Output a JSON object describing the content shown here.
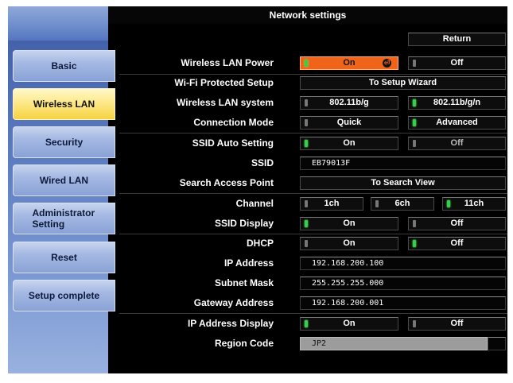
{
  "window": {
    "title": "Network settings"
  },
  "sidebar": {
    "items": [
      {
        "label": "Basic",
        "active": false
      },
      {
        "label": "Wireless LAN",
        "active": true
      },
      {
        "label": "Security",
        "active": false
      },
      {
        "label": "Wired LAN",
        "active": false
      },
      {
        "label": "Administrator Setting",
        "active": false
      },
      {
        "label": "Reset",
        "active": false
      },
      {
        "label": "Setup complete",
        "active": false
      }
    ]
  },
  "header": {
    "return_label": "Return"
  },
  "settings": {
    "wireless_lan_power": {
      "label": "Wireless LAN Power",
      "on": "On",
      "off": "Off",
      "selected": "On"
    },
    "wps": {
      "label": "Wi-Fi Protected Setup",
      "button": "To Setup Wizard"
    },
    "wireless_lan_system": {
      "label": "Wireless LAN system",
      "opt1": "802.11b/g",
      "opt2": "802.11b/g/n",
      "selected": "802.11b/g/n"
    },
    "connection_mode": {
      "label": "Connection Mode",
      "opt1": "Quick",
      "opt2": "Advanced",
      "selected": "Advanced"
    },
    "ssid_auto": {
      "label": "SSID Auto Setting",
      "on": "On",
      "off": "Off",
      "selected": "On"
    },
    "ssid": {
      "label": "SSID",
      "value": "EB79013F"
    },
    "search_ap": {
      "label": "Search Access Point",
      "button": "To Search View"
    },
    "channel": {
      "label": "Channel",
      "opt1": "1ch",
      "opt2": "6ch",
      "opt3": "11ch",
      "selected": "11ch"
    },
    "ssid_display": {
      "label": "SSID Display",
      "on": "On",
      "off": "Off",
      "selected": "On"
    },
    "dhcp": {
      "label": "DHCP",
      "on": "On",
      "off": "Off",
      "selected": "Off"
    },
    "ip_address": {
      "label": "IP Address",
      "value": "192.168.200.100"
    },
    "subnet_mask": {
      "label": "Subnet Mask",
      "value": "255.255.255.000"
    },
    "gateway": {
      "label": "Gateway Address",
      "value": "192.168.200.001"
    },
    "ip_display": {
      "label": "IP Address Display",
      "on": "On",
      "off": "Off",
      "selected": "On"
    },
    "region_code": {
      "label": "Region Code",
      "value": "JP2"
    }
  },
  "colors": {
    "selected": "#f0641a",
    "active_tab": "#f6d240",
    "led_on": "#33d04a"
  }
}
